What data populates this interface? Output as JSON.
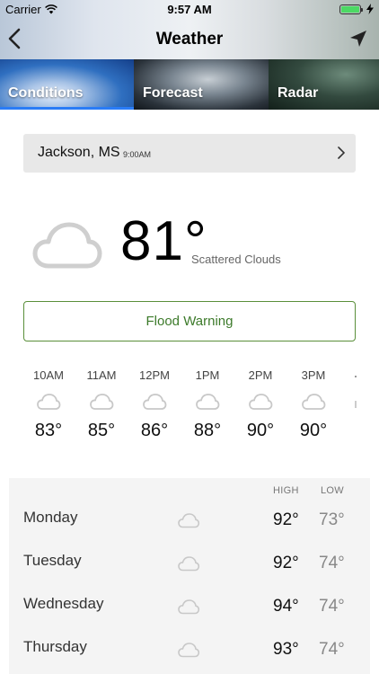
{
  "status_bar": {
    "carrier": "Carrier",
    "time": "9:57 AM"
  },
  "nav": {
    "title": "Weather"
  },
  "tabs": [
    {
      "label": "Conditions",
      "active": true
    },
    {
      "label": "Forecast",
      "active": false
    },
    {
      "label": "Radar",
      "active": false
    }
  ],
  "location": {
    "city": "Jackson, MS",
    "time": "9:00AM"
  },
  "current": {
    "temperature": "81°",
    "condition": "Scattered Clouds",
    "icon": "cloud-icon"
  },
  "alert": {
    "label": "Flood Warning",
    "color": "#3c7a2a"
  },
  "hourly": [
    {
      "time": "10AM",
      "icon": "cloud-icon",
      "temp": "83°"
    },
    {
      "time": "11AM",
      "icon": "cloud-icon",
      "temp": "85°"
    },
    {
      "time": "12PM",
      "icon": "cloud-icon",
      "temp": "86°"
    },
    {
      "time": "1PM",
      "icon": "cloud-icon",
      "temp": "88°"
    },
    {
      "time": "2PM",
      "icon": "cloud-icon",
      "temp": "90°"
    },
    {
      "time": "3PM",
      "icon": "cloud-icon",
      "temp": "90°"
    }
  ],
  "daily": {
    "high_label": "HIGH",
    "low_label": "LOW",
    "days": [
      {
        "day": "Monday",
        "icon": "cloud-icon",
        "high": "92°",
        "low": "73°"
      },
      {
        "day": "Tuesday",
        "icon": "cloud-icon",
        "high": "92°",
        "low": "74°"
      },
      {
        "day": "Wednesday",
        "icon": "cloud-icon",
        "high": "94°",
        "low": "74°"
      },
      {
        "day": "Thursday",
        "icon": "cloud-icon",
        "high": "93°",
        "low": "74°"
      }
    ]
  },
  "colors": {
    "accent": "#2a7cf6",
    "alert_border": "#5a8f3a"
  }
}
